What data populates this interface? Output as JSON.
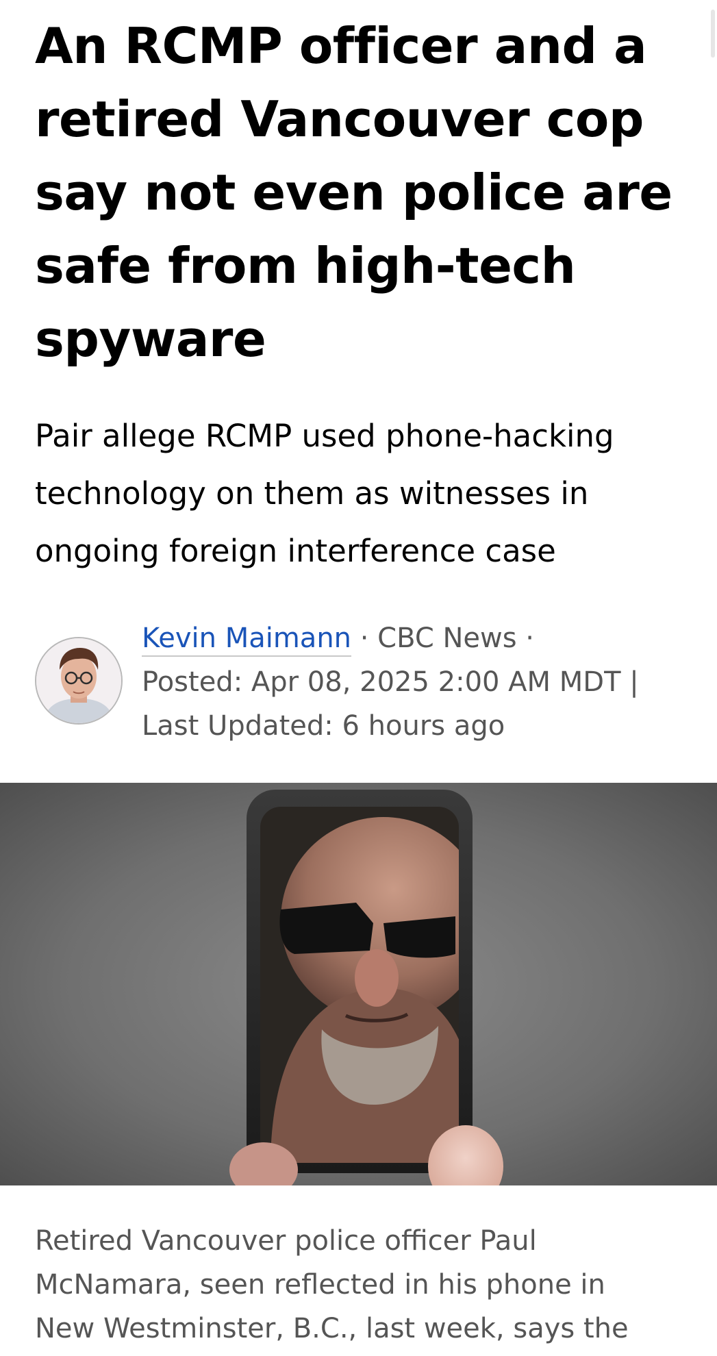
{
  "article": {
    "headline_lines": [
      "An RCMP officer and a",
      "retired Vancouver cop",
      "say not even police are",
      "safe from high-tech",
      "spyware"
    ],
    "deck_lines": [
      "Pair allege RCMP used phone-hacking",
      "technology on them as witnesses in",
      "ongoing foreign interference case"
    ],
    "byline": {
      "author": "Kevin Maimann",
      "outlet": "CBC News",
      "separator": "·",
      "posted": "Posted: Apr 08, 2025 2:00 AM MDT |",
      "updated": "Last Updated: 6 hours ago"
    },
    "caption_lines": [
      "Retired Vancouver police officer Paul",
      "McNamara, seen reflected in his phone in",
      "New Westminster, B.C., last week, says the"
    ]
  },
  "icons": {
    "avatar": "author-photo",
    "hero": "hero-photo"
  },
  "colors": {
    "link": "#1a54b8",
    "meta_text": "#555555",
    "headline_text": "#000000"
  }
}
